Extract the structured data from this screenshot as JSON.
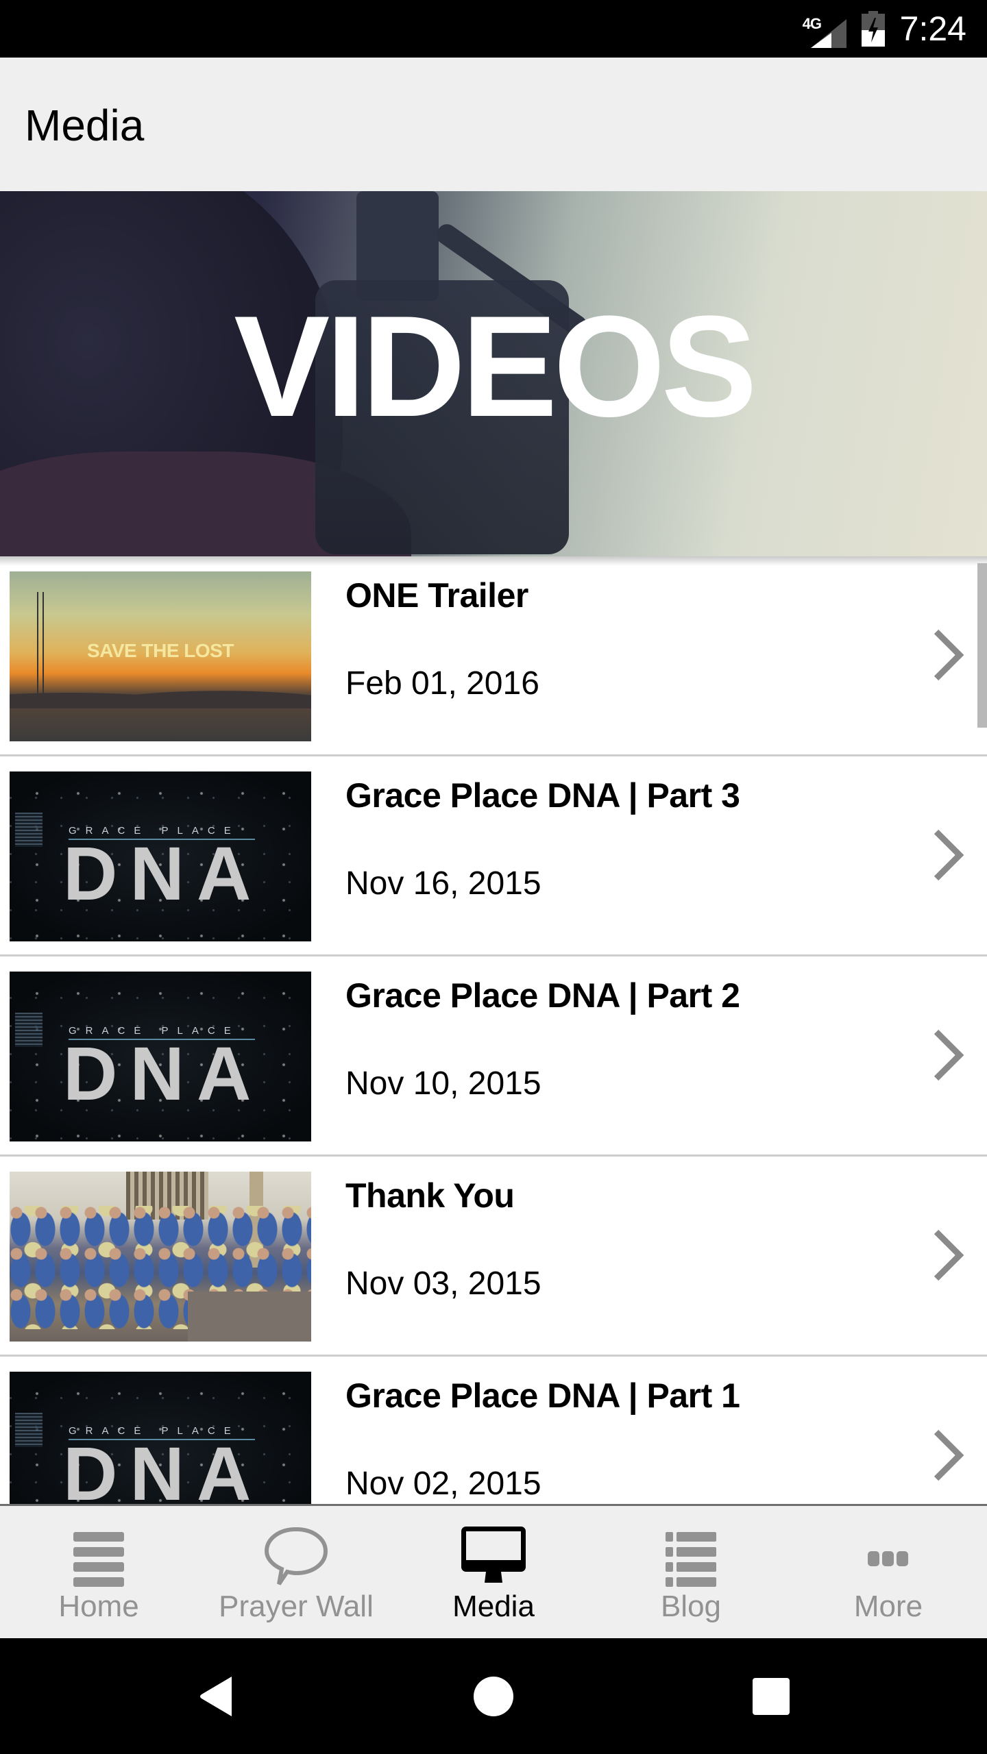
{
  "status_bar": {
    "network_label": "4G",
    "time": "7:24",
    "icons": [
      "signal-icon",
      "battery-charging-icon"
    ]
  },
  "app_bar": {
    "title": "Media"
  },
  "hero": {
    "title": "VIDEOS"
  },
  "videos": [
    {
      "title": "ONE Trailer",
      "date": "Feb 01, 2016",
      "thumbnail": "sunset",
      "thumbnail_caption": "SAVE THE LOST"
    },
    {
      "title": "Grace Place DNA | Part 3",
      "date": "Nov 16, 2015",
      "thumbnail": "dna",
      "thumbnail_sub": "GRACE PLACE",
      "thumbnail_caption": "DNA"
    },
    {
      "title": "Grace Place DNA | Part 2",
      "date": "Nov 10, 2015",
      "thumbnail": "dna",
      "thumbnail_sub": "GRACE PLACE",
      "thumbnail_caption": "DNA"
    },
    {
      "title": "Thank You",
      "date": "Nov 03, 2015",
      "thumbnail": "group-photo"
    },
    {
      "title": "Grace Place DNA | Part 1",
      "date": "Nov 02, 2015",
      "thumbnail": "dna",
      "thumbnail_sub": "GRACE PLACE",
      "thumbnail_caption": "DNA"
    }
  ],
  "bottom_nav": {
    "tabs": [
      {
        "label": "Home",
        "icon": "menu-lines-icon",
        "active": false
      },
      {
        "label": "Prayer Wall",
        "icon": "speech-bubble-icon",
        "active": false
      },
      {
        "label": "Media",
        "icon": "monitor-icon",
        "active": true
      },
      {
        "label": "Blog",
        "icon": "list-icon",
        "active": false
      },
      {
        "label": "More",
        "icon": "more-dots-icon",
        "active": false
      }
    ]
  },
  "system_nav": {
    "buttons": [
      "back",
      "home",
      "recents"
    ]
  },
  "colors": {
    "active_tab": "#000000",
    "inactive_tab": "#929292",
    "app_bar_bg": "#efefef",
    "divider": "#cdcdcd",
    "chevron": "#8a8a8a"
  }
}
